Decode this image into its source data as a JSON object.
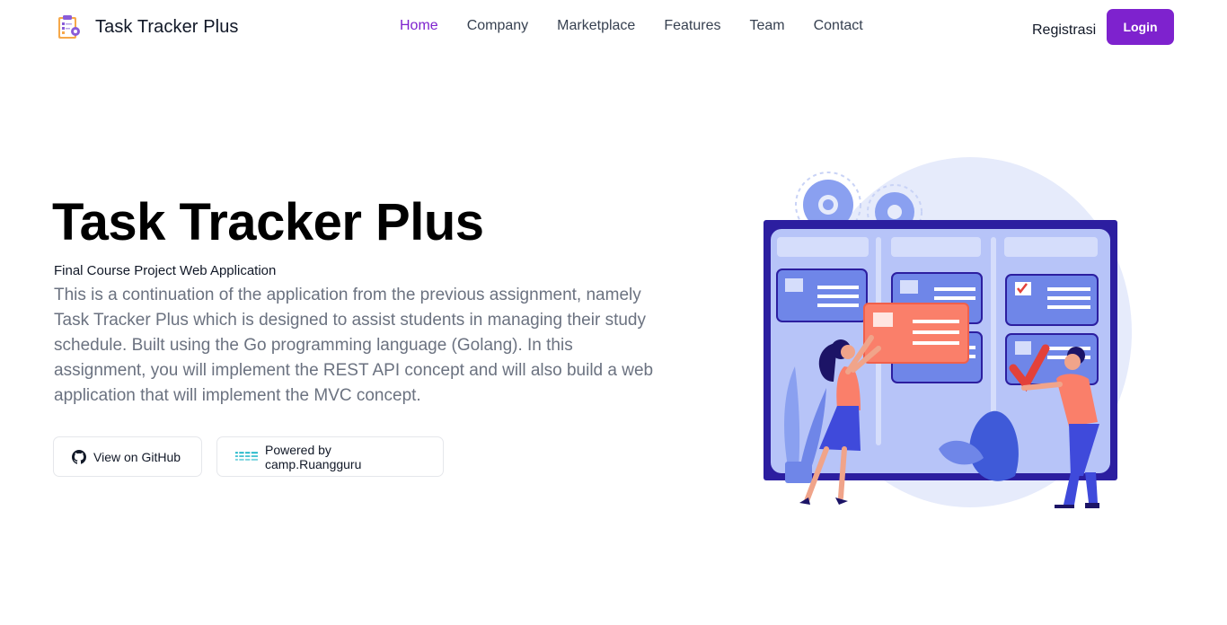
{
  "header": {
    "brand_name": "Task Tracker Plus",
    "logo_icon": "clipboard-gear-icon",
    "nav": [
      {
        "label": "Home",
        "active": true
      },
      {
        "label": "Company",
        "active": false
      },
      {
        "label": "Marketplace",
        "active": false
      },
      {
        "label": "Features",
        "active": false
      },
      {
        "label": "Team",
        "active": false
      },
      {
        "label": "Contact",
        "active": false
      }
    ],
    "register_label": "Registrasi",
    "login_label": "Login"
  },
  "hero": {
    "title": "Task Tracker Plus",
    "subtitle": "Final Course Project Web Application",
    "description": "This is a continuation of the application from the previous assignment, namely Task Tracker Plus which is designed to assist students in managing their study schedule. Built using the Go programming language (Golang). In this assignment, you will implement the REST API concept and will also build a web application that will implement the MVC concept.",
    "github_button": {
      "label": "View on GitHub",
      "icon": "github-icon"
    },
    "powered_button": {
      "label": "Powered by camp.Ruangguru",
      "icon": "ruangguru-logo-icon"
    }
  },
  "illustration": {
    "icon": "kanban-board-illustration"
  },
  "colors": {
    "accent": "#7e22ce",
    "text_primary": "#111827",
    "text_muted": "#6b7280",
    "board_dark": "#2c1ea0",
    "board_light": "#b7c4f8",
    "card_blue": "#6f86e8",
    "card_coral": "#fa7f6a"
  }
}
